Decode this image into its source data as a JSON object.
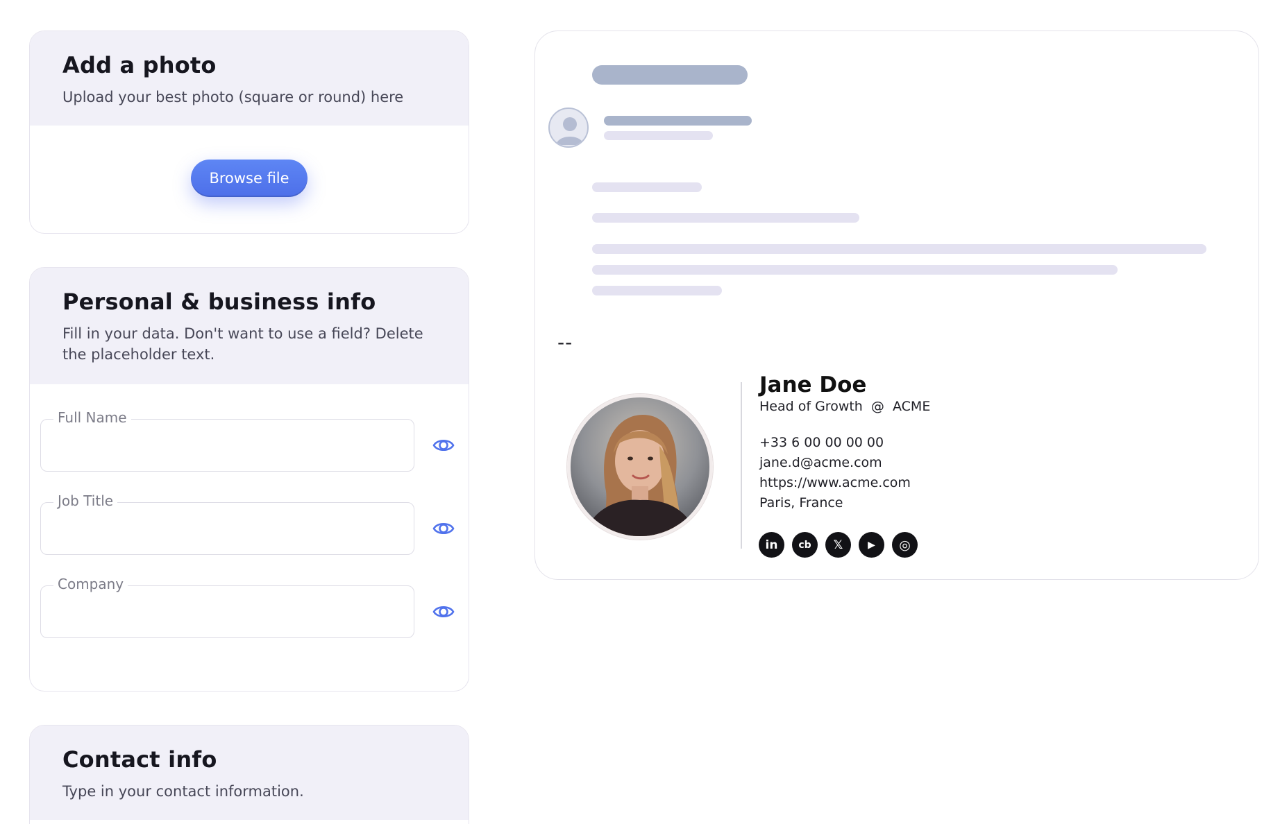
{
  "photo_card": {
    "title": "Add a photo",
    "subtitle": "Upload your best photo (square or round) here",
    "browse_label": "Browse file"
  },
  "personal_card": {
    "title": "Personal & business info",
    "subtitle": "Fill in your data. Don't want to use a field? Delete the placeholder text.",
    "fields": [
      {
        "label": "Full Name",
        "value": ""
      },
      {
        "label": "Job Title",
        "value": ""
      },
      {
        "label": "Company",
        "value": ""
      }
    ]
  },
  "contact_card": {
    "title": "Contact info",
    "subtitle": "Type in your contact information."
  },
  "preview": {
    "dash": "--",
    "signature": {
      "name": "Jane Doe",
      "role_line": "Head of Growth  @  ACME",
      "phone": "+33 6 00 00 00 00",
      "email": "jane.d@acme.com",
      "website": "https://www.acme.com",
      "location": "Paris, France",
      "socials": [
        {
          "icon": "linkedin-icon",
          "glyph": "in"
        },
        {
          "icon": "crunchbase-icon",
          "glyph": "cb"
        },
        {
          "icon": "x-icon",
          "glyph": "𝕏"
        },
        {
          "icon": "youtube-icon",
          "glyph": "▶"
        },
        {
          "icon": "instagram-icon",
          "glyph": "◎"
        }
      ]
    }
  },
  "colors": {
    "accent": "#5072ec",
    "card_head_bg": "#f1f0f8",
    "skeleton_dark": "#a9b4cb",
    "skeleton_light": "#e4e2f1"
  }
}
